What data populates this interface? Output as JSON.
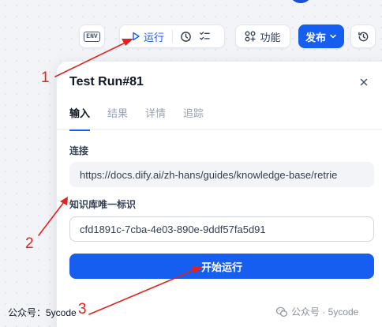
{
  "toolbar": {
    "env_badge": "ENV",
    "run_label": "运行",
    "features_label": "功能",
    "publish_label": "发布"
  },
  "panel": {
    "title": "Test Run#81",
    "tabs": [
      {
        "label": "输入"
      },
      {
        "label": "结果"
      },
      {
        "label": "详情"
      },
      {
        "label": "追踪"
      }
    ],
    "fields": {
      "link_label": "连接",
      "link_value": "https://docs.dify.ai/zh-hans/guides/knowledge-base/retrie",
      "id_label": "知识库唯一标识",
      "id_value": "cfd1891c-7cba-4e03-890e-9ddf57fa5d91"
    },
    "start_label": "开始运行"
  },
  "watermark": {
    "left": "公众号：5ycode",
    "right": "公众号 · 5ycode"
  },
  "annotations": {
    "n1": "1",
    "n2": "2",
    "n3": "3",
    "color": "#e5211d"
  },
  "colors": {
    "primary": "#155eef"
  }
}
